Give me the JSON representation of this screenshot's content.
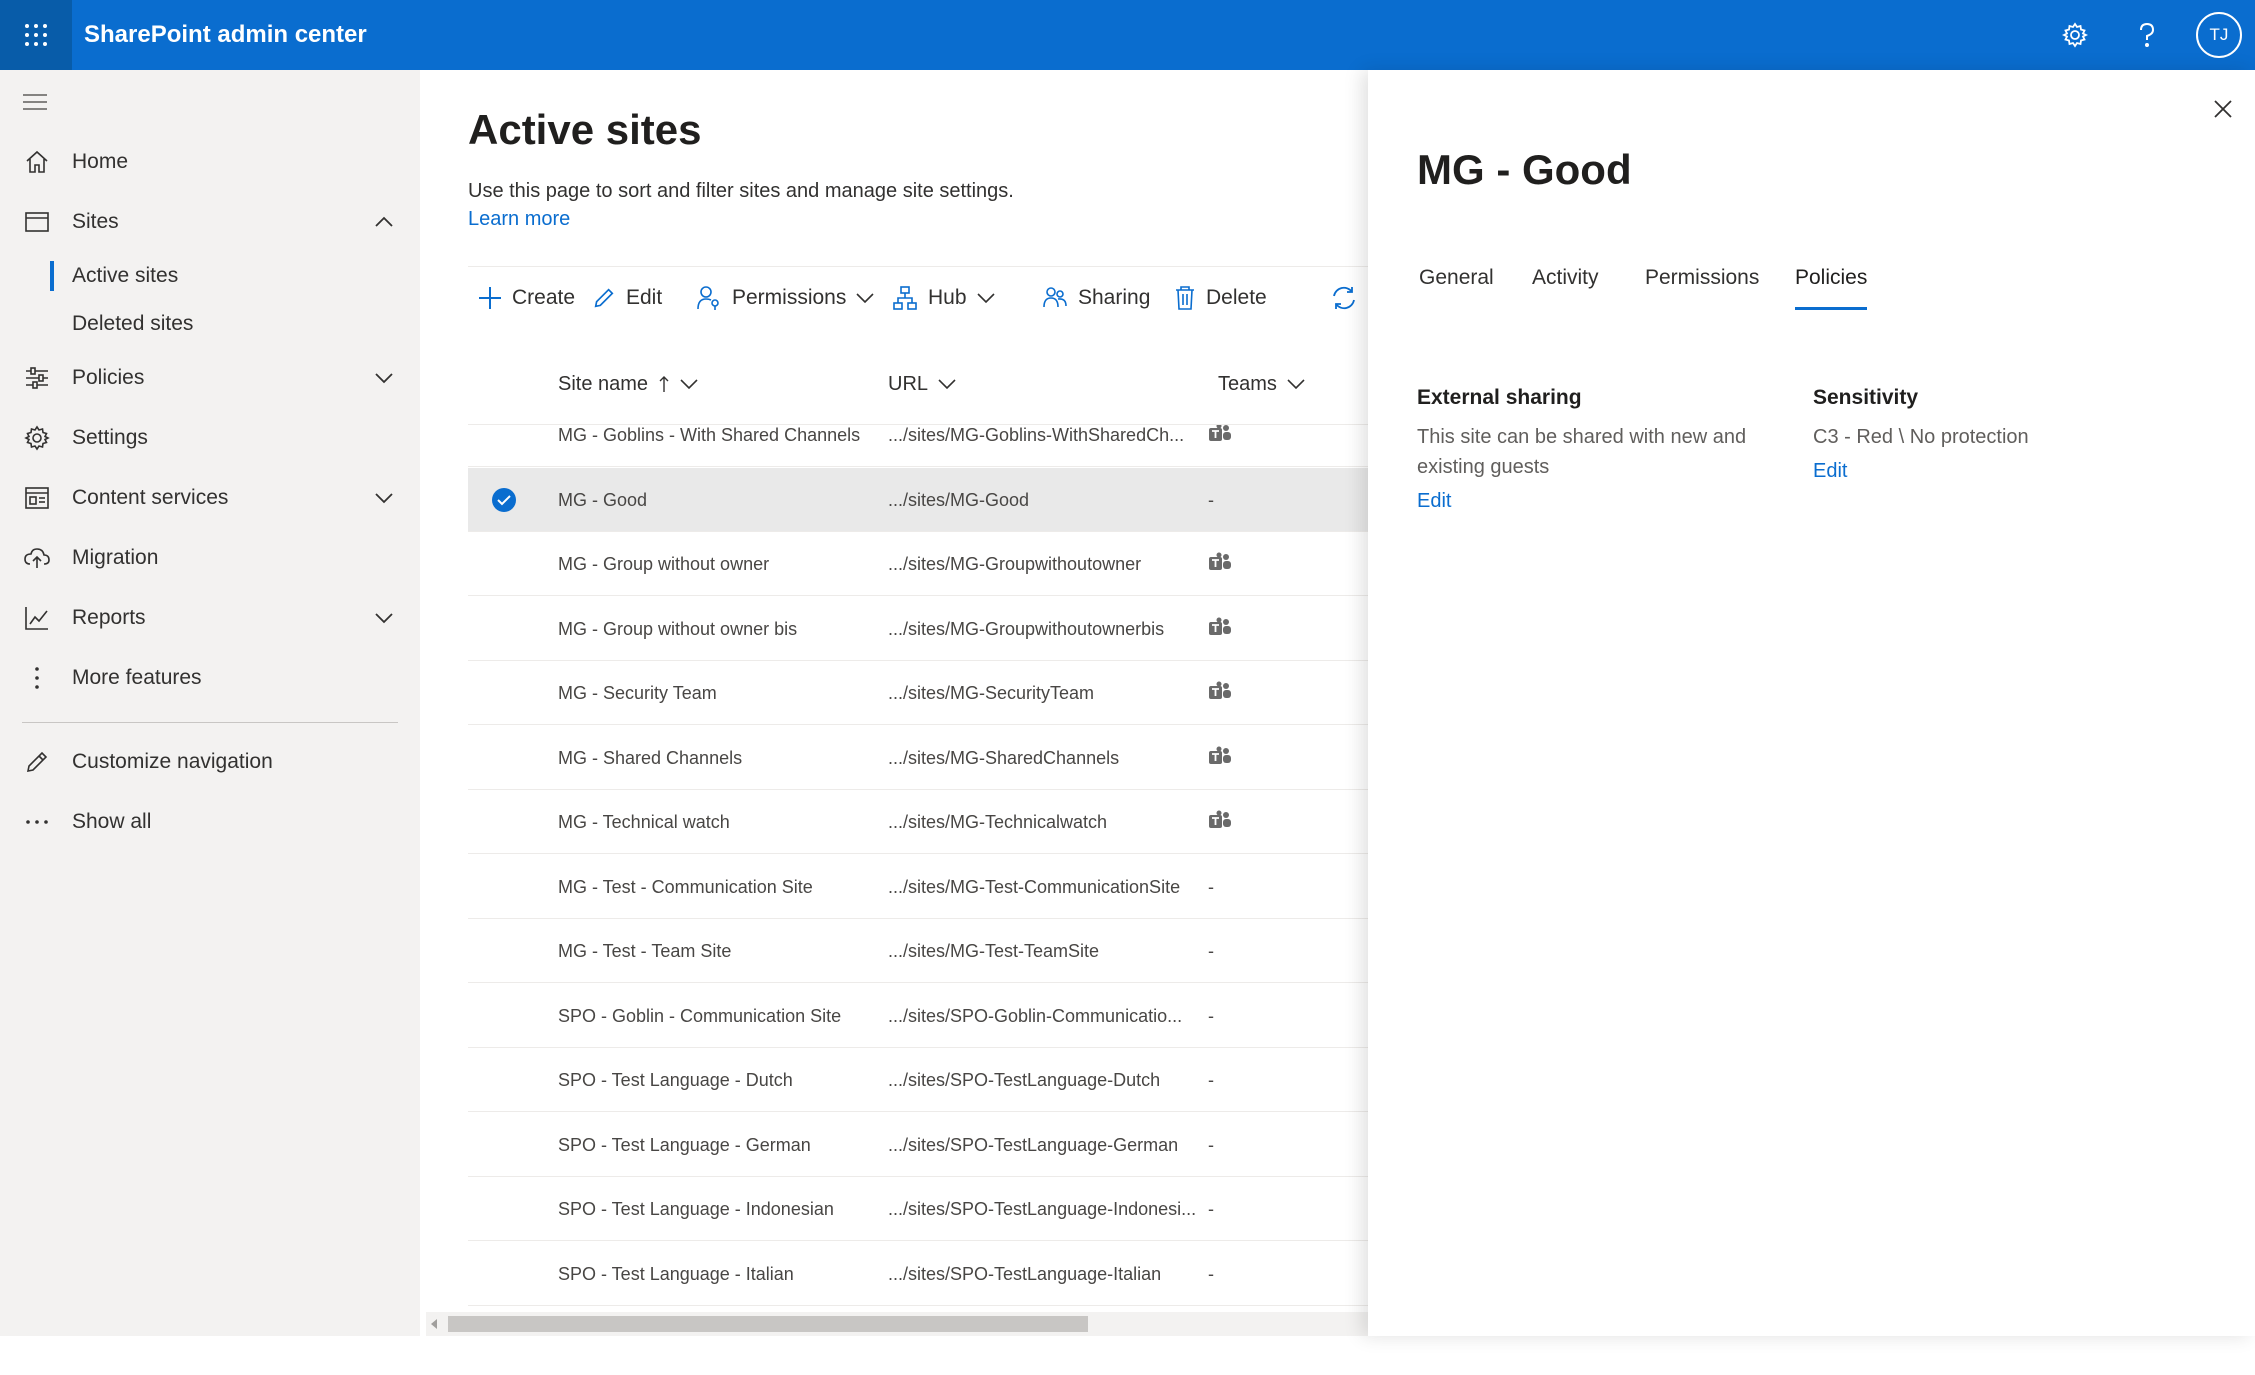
{
  "header": {
    "app_title": "SharePoint admin center",
    "avatar_initials": "TJ",
    "brand_color": "#0a6dcf"
  },
  "nav": {
    "home": "Home",
    "sites": "Sites",
    "active_sites": "Active sites",
    "deleted_sites": "Deleted sites",
    "policies": "Policies",
    "settings": "Settings",
    "content_services": "Content services",
    "migration": "Migration",
    "reports": "Reports",
    "more_features": "More features",
    "customize_navigation": "Customize navigation",
    "show_all": "Show all"
  },
  "main": {
    "title": "Active sites",
    "description": "Use this page to sort and filter sites and manage site settings.",
    "learn_more": "Learn more"
  },
  "commands": {
    "create": "Create",
    "edit": "Edit",
    "permissions": "Permissions",
    "hub": "Hub",
    "sharing": "Sharing",
    "delete": "Delete"
  },
  "columns": {
    "site_name": "Site name",
    "url": "URL",
    "teams": "Teams"
  },
  "rows": [
    {
      "name": "MG - Goblins - With Shared Channels",
      "url": ".../sites/MG-Goblins-WithSharedCh...",
      "teams": true,
      "selected": false
    },
    {
      "name": "MG - Good",
      "url": ".../sites/MG-Good",
      "teams": false,
      "selected": true
    },
    {
      "name": "MG - Group without owner",
      "url": ".../sites/MG-Groupwithoutowner",
      "teams": true,
      "selected": false
    },
    {
      "name": "MG - Group without owner bis",
      "url": ".../sites/MG-Groupwithoutownerbis",
      "teams": true,
      "selected": false
    },
    {
      "name": "MG - Security Team",
      "url": ".../sites/MG-SecurityTeam",
      "teams": true,
      "selected": false
    },
    {
      "name": "MG - Shared Channels",
      "url": ".../sites/MG-SharedChannels",
      "teams": true,
      "selected": false
    },
    {
      "name": "MG - Technical watch",
      "url": ".../sites/MG-Technicalwatch",
      "teams": true,
      "selected": false
    },
    {
      "name": "MG - Test - Communication Site",
      "url": ".../sites/MG-Test-CommunicationSite",
      "teams": false,
      "selected": false
    },
    {
      "name": "MG - Test - Team Site",
      "url": ".../sites/MG-Test-TeamSite",
      "teams": false,
      "selected": false
    },
    {
      "name": "SPO - Goblin - Communication Site",
      "url": ".../sites/SPO-Goblin-Communicatio...",
      "teams": false,
      "selected": false
    },
    {
      "name": "SPO - Test Language - Dutch",
      "url": ".../sites/SPO-TestLanguage-Dutch",
      "teams": false,
      "selected": false
    },
    {
      "name": "SPO - Test Language - German",
      "url": ".../sites/SPO-TestLanguage-German",
      "teams": false,
      "selected": false
    },
    {
      "name": "SPO - Test Language - Indonesian",
      "url": ".../sites/SPO-TestLanguage-Indonesi...",
      "teams": false,
      "selected": false
    },
    {
      "name": "SPO - Test Language - Italian",
      "url": ".../sites/SPO-TestLanguage-Italian",
      "teams": false,
      "selected": false
    }
  ],
  "no_teams_text": "-",
  "panel": {
    "title": "MG - Good",
    "tabs": [
      "General",
      "Activity",
      "Permissions",
      "Policies"
    ],
    "active_tab": "Policies",
    "external_sharing": {
      "title": "External sharing",
      "text_line1": "This site can be shared with new and",
      "text_line2": "existing guests",
      "edit": "Edit"
    },
    "sensitivity": {
      "title": "Sensitivity",
      "text": "C3 - Red \\ No protection",
      "edit": "Edit"
    }
  }
}
